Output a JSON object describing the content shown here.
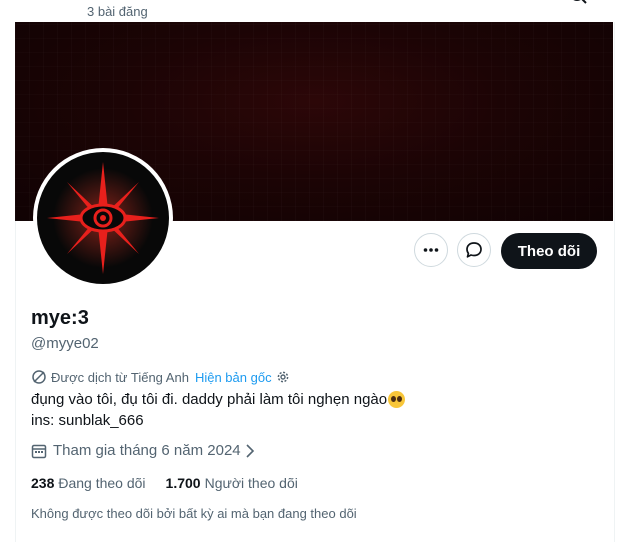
{
  "header": {
    "post_count": "3 bài đăng"
  },
  "profile": {
    "display_name": "mye:3",
    "handle": "@myye02",
    "follow_label": "Theo dõi",
    "translated_from": "Được dịch từ Tiếng Anh",
    "show_original": "Hiện bản gốc",
    "bio_line1": "đụng vào tôi, đụ tôi đi. daddy phải làm tôi nghẹn ngào",
    "bio_line2": "ins: sunblak_666",
    "joined": "Tham gia tháng 6 năm 2024",
    "following_count": "238",
    "following_label": "Đang theo dõi",
    "followers_count": "1.700",
    "followers_label": "Người theo dõi",
    "not_followed_note": "Không được theo dõi bởi bất kỳ ai mà bạn đang theo dõi"
  },
  "icons": {
    "back": "arrow-left-icon",
    "search": "search-icon",
    "more": "more-horizontal-icon",
    "message": "message-bubble-icon",
    "translate": "translate-icon",
    "settings": "gear-icon",
    "calendar": "calendar-icon",
    "chevron": "chevron-right-icon",
    "emoji": "pleading-face-emoji"
  },
  "colors": {
    "accent": "#1d9bf0",
    "follow_button": "#0f1419",
    "secondary_text": "#536471",
    "avatar_symbol": "#e8201c"
  }
}
